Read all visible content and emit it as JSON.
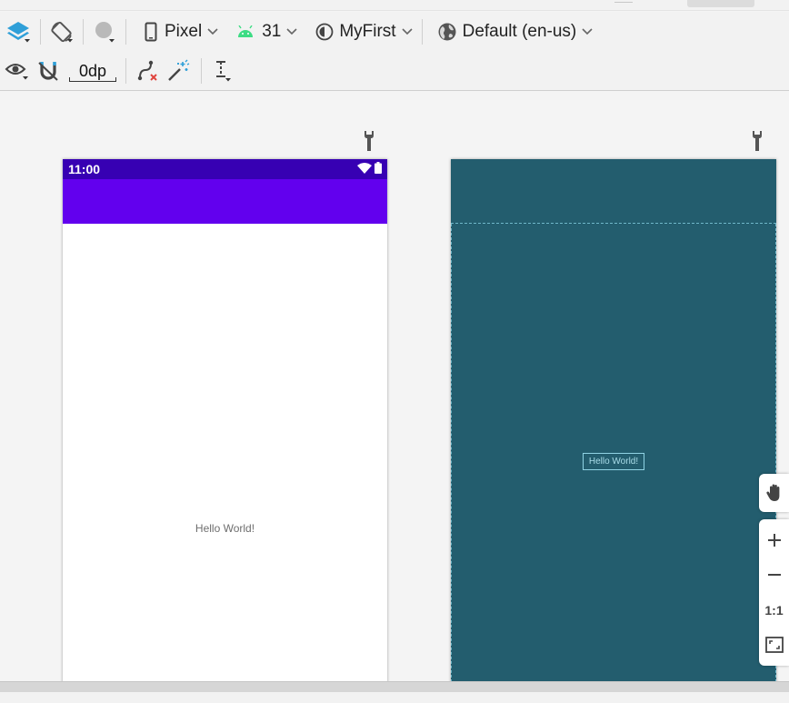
{
  "toolbar": {
    "device": "Pixel",
    "api_level": "31",
    "theme": "MyFirst",
    "locale": "Default (en-us)",
    "margin_value": "0dp"
  },
  "design_preview": {
    "status_time": "11:00",
    "hello_text": "Hello World!"
  },
  "blueprint_preview": {
    "hello_text": "Hello World!"
  },
  "zoom_controls": {
    "actual_size_label": "1:1"
  },
  "colors": {
    "status_bar": "#3700b3",
    "app_bar": "#6200ee",
    "blueprint": "#235d6e",
    "android_green": "#3ddc84"
  }
}
